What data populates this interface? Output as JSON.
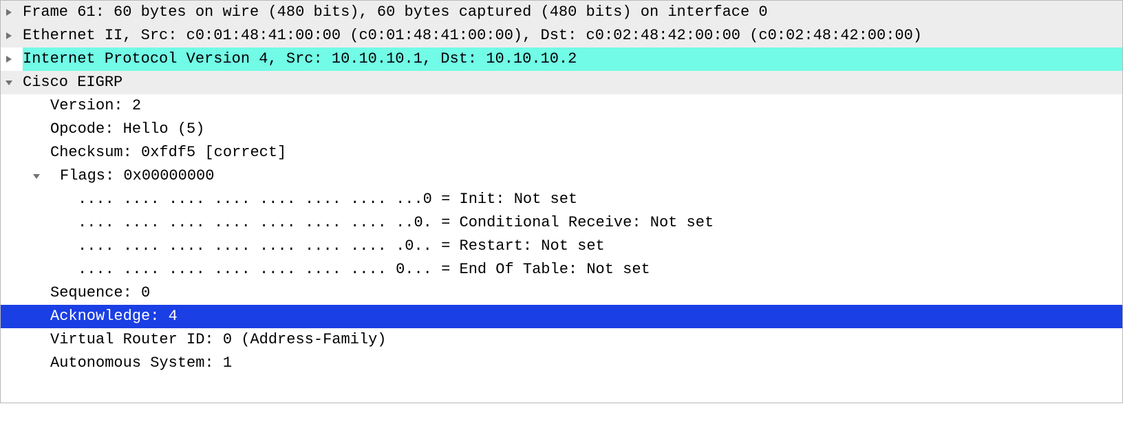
{
  "rows": {
    "frame": "Frame 61: 60 bytes on wire (480 bits), 60 bytes captured (480 bits) on interface 0",
    "eth": "Ethernet II, Src: c0:01:48:41:00:00 (c0:01:48:41:00:00), Dst: c0:02:48:42:00:00 (c0:02:48:42:00:00)",
    "ip": "Internet Protocol Version 4, Src: 10.10.10.1, Dst: 10.10.10.2",
    "eigrp": "Cisco EIGRP",
    "version": "Version: 2",
    "opcode": "Opcode: Hello (5)",
    "checksum": "Checksum: 0xfdf5 [correct]",
    "flags": "Flags: 0x00000000",
    "flag_init": ".... .... .... .... .... .... .... ...0 = Init: Not set",
    "flag_cond": ".... .... .... .... .... .... .... ..0. = Conditional Receive: Not set",
    "flag_restart": ".... .... .... .... .... .... .... .0.. = Restart: Not set",
    "flag_eot": ".... .... .... .... .... .... .... 0... = End Of Table: Not set",
    "sequence": "Sequence: 0",
    "ack": "Acknowledge: 4",
    "vrid": "Virtual Router ID: 0 (Address-Family)",
    "as": "Autonomous System: 1"
  }
}
